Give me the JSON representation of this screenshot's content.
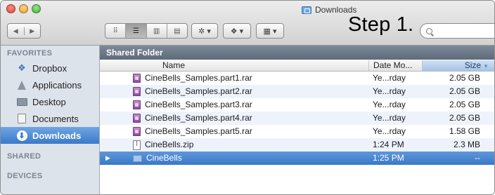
{
  "window": {
    "title": "Downloads"
  },
  "toolbar": {
    "back_label": "◀",
    "forward_label": "▶",
    "views": [
      "⠿",
      "☰",
      "▥",
      "▤"
    ],
    "action_label": "✲ ▾",
    "share_label": "❖ ▾",
    "arrange_label": "▦ ▾",
    "overlay_text": "Step 1.",
    "search_placeholder": ""
  },
  "sidebar": {
    "sections": [
      "FAVORITES",
      "SHARED",
      "DEVICES"
    ],
    "items": [
      {
        "label": "Dropbox",
        "icon": "dropbox-icon"
      },
      {
        "label": "Applications",
        "icon": "applications-icon"
      },
      {
        "label": "Desktop",
        "icon": "desktop-icon"
      },
      {
        "label": "Documents",
        "icon": "documents-icon"
      },
      {
        "label": "Downloads",
        "icon": "downloads-icon",
        "selected": true
      }
    ]
  },
  "main": {
    "path_title": "Shared Folder",
    "columns": {
      "name": "Name",
      "date": "Date Mo...",
      "size": "Size"
    },
    "rows": [
      {
        "name": "CineBells_Samples.part1.rar",
        "date": "Ye...rday",
        "size": "2.05 GB",
        "type": "rar"
      },
      {
        "name": "CineBells_Samples.part2.rar",
        "date": "Ye...rday",
        "size": "2.05 GB",
        "type": "rar"
      },
      {
        "name": "CineBells_Samples.part3.rar",
        "date": "Ye...rday",
        "size": "2.05 GB",
        "type": "rar"
      },
      {
        "name": "CineBells_Samples.part4.rar",
        "date": "Ye...rday",
        "size": "2.05 GB",
        "type": "rar"
      },
      {
        "name": "CineBells_Samples.part5.rar",
        "date": "Ye...rday",
        "size": "1.58 GB",
        "type": "rar"
      },
      {
        "name": "CineBells.zip",
        "date": "1:24 PM",
        "size": "2.3 MB",
        "type": "zip"
      },
      {
        "name": "CineBells",
        "date": "1:25 PM",
        "size": "--",
        "type": "folder",
        "selected": true
      }
    ]
  },
  "colors": {
    "selection": "#3b78c6",
    "sidebar_bg": "#dde3ea",
    "path_bar": "#6b7888"
  }
}
